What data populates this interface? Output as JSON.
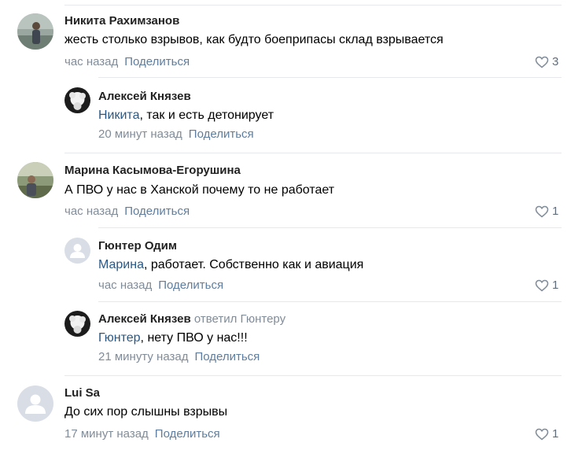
{
  "comments": [
    {
      "author": "Никита Рахимзанов",
      "text": "жесть столько взрывов, как будто боеприпасы склад взрывается",
      "time": "час назад",
      "share": "Поделиться",
      "likes": "3"
    },
    {
      "author": "Алексей Князев",
      "mention": "Никита",
      "text": ", так и есть детонирует",
      "time": "20 минут назад",
      "share": "Поделиться"
    },
    {
      "author": "Марина Касымова-Егорушина",
      "text": "А ПВО у нас в Ханской почему то не работает",
      "time": "час назад",
      "share": "Поделиться",
      "likes": "1"
    },
    {
      "author": "Гюнтер Одим",
      "mention": "Марина",
      "text": ", работает. Собственно как и авиация",
      "time": "час назад",
      "share": "Поделиться",
      "likes": "1"
    },
    {
      "author": "Алексей Князев",
      "replied": "ответил Гюнтеру",
      "mention": "Гюнтер",
      "text": ", нету ПВО у нас!!!",
      "time": "21 минуту назад",
      "share": "Поделиться"
    },
    {
      "author": "Lui Sa",
      "text": "До сих пор слышны взрывы",
      "time": "17 минут назад",
      "share": "Поделиться",
      "likes": "1"
    }
  ],
  "colors": {
    "link": "#2a5885",
    "meta": "#818c99",
    "separator": "#e7e8ec"
  }
}
